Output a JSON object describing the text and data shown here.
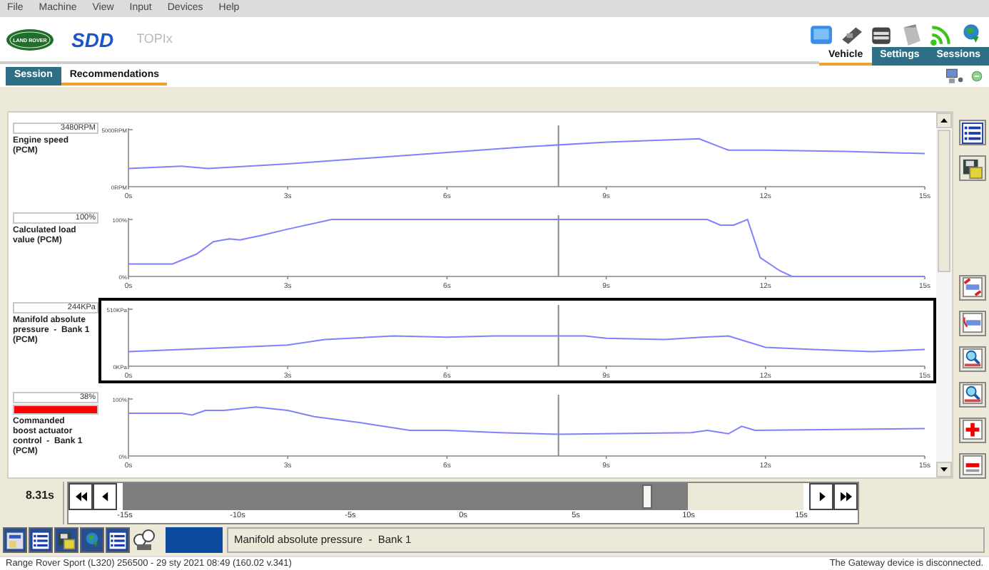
{
  "menu": [
    "File",
    "Machine",
    "View",
    "Input",
    "Devices",
    "Help"
  ],
  "header": {
    "logo_text": "LAND ROVER",
    "brand": "SDD",
    "product": "TOPIx",
    "tabs": [
      {
        "label": "Vehicle",
        "selected": true
      },
      {
        "label": "Settings",
        "selected": false
      },
      {
        "label": "Sessions",
        "selected": false
      }
    ]
  },
  "session_tabs": [
    {
      "label": "Session",
      "selected": false
    },
    {
      "label": "Recommendations",
      "selected": true
    }
  ],
  "channels": [
    {
      "value": "3480RPM",
      "name": "Engine speed\n(PCM)",
      "warning": false,
      "selected": false,
      "chart_data": {
        "type": "line",
        "x": [
          0,
          1,
          1.5,
          3,
          4.5,
          6,
          7.5,
          9,
          10.75,
          11.3,
          12,
          13.5,
          15
        ],
        "series": [
          {
            "color": "#8080ff",
            "values": [
              1600,
              1800,
              1600,
              2000,
              2500,
              3000,
              3500,
              3900,
              4200,
              3200,
              3200,
              3100,
              2900
            ]
          }
        ],
        "xlim": [
          0,
          15
        ],
        "ylim": [
          0,
          5000
        ],
        "xticks": [
          {
            "value": 0,
            "label": "0s"
          },
          {
            "value": 3,
            "label": "3s"
          },
          {
            "value": 6,
            "label": "6s"
          },
          {
            "value": 9,
            "label": "9s"
          },
          {
            "value": 12,
            "label": "12s"
          },
          {
            "value": 15,
            "label": "15s"
          }
        ],
        "yticks": [
          {
            "value": 0,
            "label": "0RPM"
          },
          {
            "value": 5000,
            "label": "5000RPM"
          }
        ],
        "ref_lines": [
          {
            "axis": "x",
            "value": 8.1,
            "color": "#888888"
          }
        ]
      }
    },
    {
      "value": "100%",
      "name": "Calculated load\nvalue (PCM)",
      "warning": false,
      "selected": false,
      "chart_data": {
        "type": "line",
        "x": [
          0,
          0.83,
          1.28,
          1.6,
          1.9,
          2.1,
          2.5,
          3,
          3.83,
          10.9,
          11.15,
          11.4,
          11.66,
          11.9,
          12.27,
          12.5,
          15
        ],
        "series": [
          {
            "color": "#8080ff",
            "values": [
              22,
              22,
              39,
              61,
              66,
              64,
              72,
              83,
              100,
              100,
              90,
              90,
              100,
              33,
              10,
              0,
              0
            ]
          }
        ],
        "xlim": [
          0,
          15
        ],
        "ylim": [
          0,
          100
        ],
        "xticks": [
          {
            "value": 0,
            "label": "0s"
          },
          {
            "value": 3,
            "label": "3s"
          },
          {
            "value": 6,
            "label": "6s"
          },
          {
            "value": 9,
            "label": "9s"
          },
          {
            "value": 12,
            "label": "12s"
          },
          {
            "value": 15,
            "label": "15s"
          }
        ],
        "yticks": [
          {
            "value": 0,
            "label": "0%"
          },
          {
            "value": 100,
            "label": "100%"
          }
        ],
        "ref_lines": [
          {
            "axis": "x",
            "value": 8.1,
            "color": "#888888"
          }
        ]
      }
    },
    {
      "value": "244KPa",
      "name": "Manifold absolute\npressure  -  Bank 1\n(PCM)",
      "warning": false,
      "selected": true,
      "chart_data": {
        "type": "line",
        "x": [
          0,
          1,
          2,
          3,
          3.7,
          5,
          6,
          6.9,
          8.1,
          8.6,
          9,
          10.1,
          10.8,
          11.3,
          12,
          12.9,
          14,
          15
        ],
        "series": [
          {
            "color": "#8080ff",
            "values": [
              130,
              150,
              170,
              190,
              240,
              270,
              260,
              270,
              270,
              270,
              250,
              240,
              260,
              270,
              170,
              150,
              130,
              150
            ]
          }
        ],
        "xlim": [
          0,
          15
        ],
        "ylim": [
          0,
          510
        ],
        "xticks": [
          {
            "value": 0,
            "label": "0s"
          },
          {
            "value": 3,
            "label": "3s"
          },
          {
            "value": 6,
            "label": "6s"
          },
          {
            "value": 9,
            "label": "9s"
          },
          {
            "value": 12,
            "label": "12s"
          },
          {
            "value": 15,
            "label": "15s"
          }
        ],
        "yticks": [
          {
            "value": 0,
            "label": "0KPa"
          },
          {
            "value": 510,
            "label": "510KPa"
          }
        ],
        "ref_lines": [
          {
            "axis": "x",
            "value": 8.1,
            "color": "#888888"
          }
        ]
      }
    },
    {
      "value": "38%",
      "name": "Commanded\nboost actuator\ncontrol  -  Bank 1\n(PCM)",
      "warning": true,
      "selected": false,
      "chart_data": {
        "type": "line",
        "x": [
          0,
          1,
          1.2,
          1.45,
          1.8,
          2.4,
          3,
          3.5,
          4.4,
          5.3,
          6,
          7,
          8.1,
          10.6,
          10.9,
          11.3,
          11.55,
          11.8,
          15
        ],
        "series": [
          {
            "color": "#8080ff",
            "values": [
              75,
              75,
              72,
              80,
              80,
              86,
              80,
              69,
              58,
              45,
              45,
              41,
              38,
              41,
              45,
              39,
              52,
              45,
              48
            ]
          }
        ],
        "xlim": [
          0,
          15
        ],
        "ylim": [
          0,
          100
        ],
        "xticks": [
          {
            "value": 0,
            "label": "0s"
          },
          {
            "value": 3,
            "label": "3s"
          },
          {
            "value": 6,
            "label": "6s"
          },
          {
            "value": 9,
            "label": "9s"
          },
          {
            "value": 12,
            "label": "12s"
          },
          {
            "value": 15,
            "label": "15s"
          }
        ],
        "yticks": [
          {
            "value": 0,
            "label": "0%"
          },
          {
            "value": 100,
            "label": "100%"
          }
        ],
        "ref_lines": [
          {
            "axis": "x",
            "value": 8.1,
            "color": "#888888"
          }
        ]
      }
    }
  ],
  "timeline": {
    "time": "8.31s",
    "level": 0.77,
    "recorded": {
      "level": 0.83
    },
    "axis_labels": [
      "-15s",
      "-10s",
      "-5s",
      "0s",
      "5s",
      "10s",
      "15s"
    ]
  },
  "selected_channel_field": "Manifold absolute pressure  -  Bank 1",
  "status_bar": {
    "vehicle_info": "Range Rover Sport (L320) 256500 - 29 sty 2021 08:49 (160.02 v.341)",
    "connection": "The Gateway device is disconnected."
  }
}
